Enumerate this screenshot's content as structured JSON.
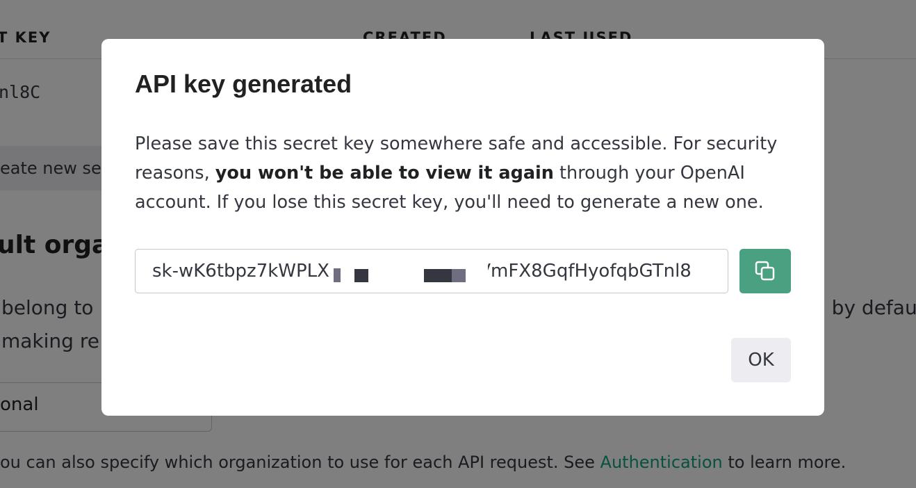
{
  "background": {
    "table_headers": {
      "secret_key": "T KEY",
      "created": "CREATED",
      "last_used": "LAST USED"
    },
    "key_fragment": "nl8C",
    "create_button_label": "eate new se",
    "default_org_title": "ult orga",
    "desc_line1_left": "belong to",
    "desc_line1_right": "l by defau",
    "desc_line2_left": "making re",
    "org_select_value": "onal",
    "footer": {
      "text_before": "ou can also specify which organization to use for each API request. See ",
      "link": "Authentication",
      "text_after": " to learn more."
    }
  },
  "modal": {
    "title": "API key generated",
    "desc_part1": "Please save this secret key somewhere safe and accessible. For security reasons, ",
    "desc_bold": "you won't be able to view it again",
    "desc_part2": " through your OpenAI account. If you lose this secret key, you'll need to generate a new one.",
    "key_value": "sk-wK6tbpz7kWPLX                         JVmFX8GqfHyofqbGTnl8",
    "copy_icon": "copy-icon",
    "ok_label": "OK"
  },
  "colors": {
    "accent": "#10a37f",
    "copy_button": "#4aa181",
    "overlay": "rgba(0,0,0,0.5)"
  }
}
